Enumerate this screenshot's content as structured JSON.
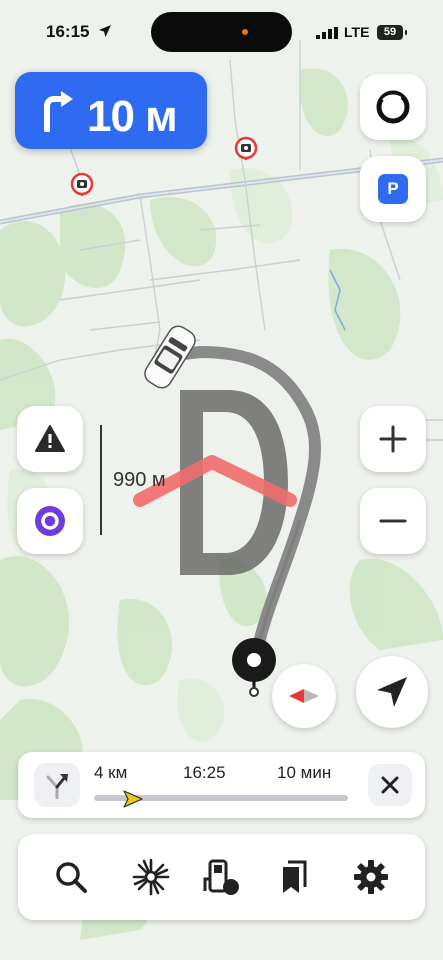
{
  "status_bar": {
    "time": "16:15",
    "network": "LTE",
    "battery": "59",
    "location_icon": "location-arrow-icon",
    "signal_icon": "signal-bars-icon"
  },
  "maneuver": {
    "icon": "turn-right-icon",
    "distance": "10 м"
  },
  "map": {
    "scale_label": "990 м",
    "road_sign": "D",
    "colors": {
      "route": "#8a8a8a",
      "maneuver_chevron": "#f06b6b",
      "forest": "#cfe6c6",
      "road": "#b9c4cf"
    }
  },
  "controls": {
    "parking_label": "P",
    "zoom_in_label": "+",
    "zoom_out_label": "−"
  },
  "route_bar": {
    "distance": "4 км",
    "arrival_time": "16:25",
    "duration": "10 мин",
    "progress": 0.12
  },
  "bottom_bar": {
    "tools": [
      "search-icon",
      "sparkle-icon",
      "fuel-station-icon",
      "bookmarks-icon",
      "settings-gear-icon"
    ]
  },
  "colors": {
    "accent": "#2f6bf0",
    "alice": "#6f3bdc",
    "compass_red": "#e53935"
  }
}
